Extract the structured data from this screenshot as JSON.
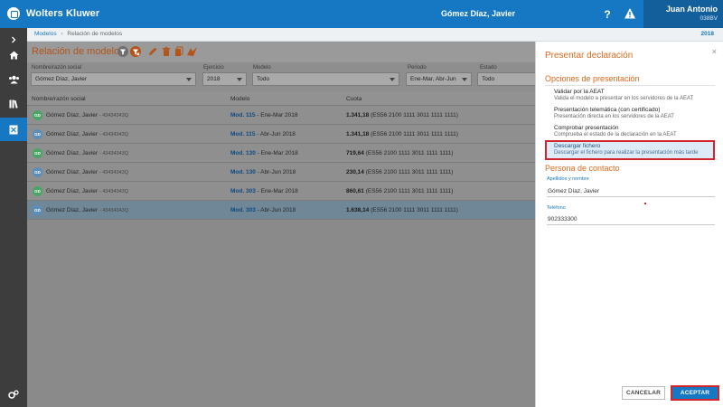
{
  "topbar": {
    "brand": "Wolters Kluwer",
    "client": "Gómez Díaz, Javier",
    "help_glyph": "?",
    "user_name": "Juan Antonio",
    "user_id": "038BV"
  },
  "breadcrumb": {
    "link": "Modelos",
    "separator": "›",
    "current": "Relación de modelos",
    "year": "2018"
  },
  "main": {
    "title": "Relación de modelos",
    "filters": [
      {
        "label": "Nombre/razón social",
        "value": "Gómez Díaz, Javier"
      },
      {
        "label": "Ejercicio",
        "value": "2018"
      },
      {
        "label": "Modelo",
        "value": "Todo"
      },
      {
        "label": "Periodo",
        "value": "Ene-Mar, Abr-Jun"
      },
      {
        "label": "Estado",
        "value": "Todo"
      }
    ],
    "columns": [
      "Nombre/razón social",
      "Modelo",
      "Cuota"
    ],
    "rows": [
      {
        "initials": "GD",
        "avatar_color": "#4aa564",
        "name": "Gómez Díaz, Javier",
        "nif": "- 43434343Q",
        "model": "Mod. 115",
        "period": "- Ene-Mar 2018",
        "amount": "1.341,18",
        "iban": "(ES56 2100 1111 3011 1111 1111)"
      },
      {
        "initials": "GD",
        "avatar_color": "#5b8fb9",
        "name": "Gómez Díaz, Javier",
        "nif": "- 43434343Q",
        "model": "Mod. 115",
        "period": "- Abr-Jun 2018",
        "amount": "1.341,18",
        "iban": "(ES56 2100 1111 3011 1111 1111)"
      },
      {
        "initials": "GD",
        "avatar_color": "#4aa564",
        "name": "Gómez Díaz, Javier",
        "nif": "- 43434343Q",
        "model": "Mod. 130",
        "period": "- Ene-Mar 2018",
        "amount": "719,64",
        "iban": "(ES56 2100 1111 3011 1111 1111)"
      },
      {
        "initials": "GD",
        "avatar_color": "#5b8fb9",
        "name": "Gómez Díaz, Javier",
        "nif": "- 43434343Q",
        "model": "Mod. 130",
        "period": "- Abr-Jun 2018",
        "amount": "230,14",
        "iban": "(ES56 2100 1111 3011 1111 1111)"
      },
      {
        "initials": "GD",
        "avatar_color": "#4aa564",
        "name": "Gómez Díaz, Javier",
        "nif": "- 43434343Q",
        "model": "Mod. 303",
        "period": "- Ene-Mar 2018",
        "amount": "860,61",
        "iban": "(ES56 2100 1111 3011 1111 1111)"
      },
      {
        "initials": "GD",
        "avatar_color": "#5b8fb9",
        "name": "Gómez Díaz, Javier",
        "nif": "- 43434343Q",
        "model": "Mod. 303",
        "period": "- Abr-Jun 2018",
        "amount": "1.638,14",
        "iban": "(ES56 2100 1111 3011 1111 1111)"
      }
    ]
  },
  "panel": {
    "close_glyph": "×",
    "title": "Presentar declaración",
    "options_heading": "Opciones de presentación",
    "options": [
      {
        "title": "Validar por la AEAT",
        "desc": "Valida el modelo a presentar en los servidores de la AEAT"
      },
      {
        "title": "Presentación telemática (con certificado)",
        "desc": "Presentación directa en los servidores de la AEAT"
      },
      {
        "title": "Comprobar presentación",
        "desc": "Comprueba el estado de la declaración en la AEAT"
      },
      {
        "title": "Descargar fichero",
        "desc": "Descargar el fichero para realizar la presentación más tarde"
      }
    ],
    "contact_heading": "Persona de contacto",
    "name_label": "Apellidos y nombre",
    "name_value": "Gómez Díaz, Javier",
    "phone_label": "Teléfono",
    "phone_value": "902333300",
    "cancel_label": "CANCELAR",
    "accept_label": "ACEPTAR"
  },
  "colors": {
    "brand_blue": "#1678c2",
    "accent_orange": "#d9681b",
    "highlight_red": "#d3242c"
  }
}
